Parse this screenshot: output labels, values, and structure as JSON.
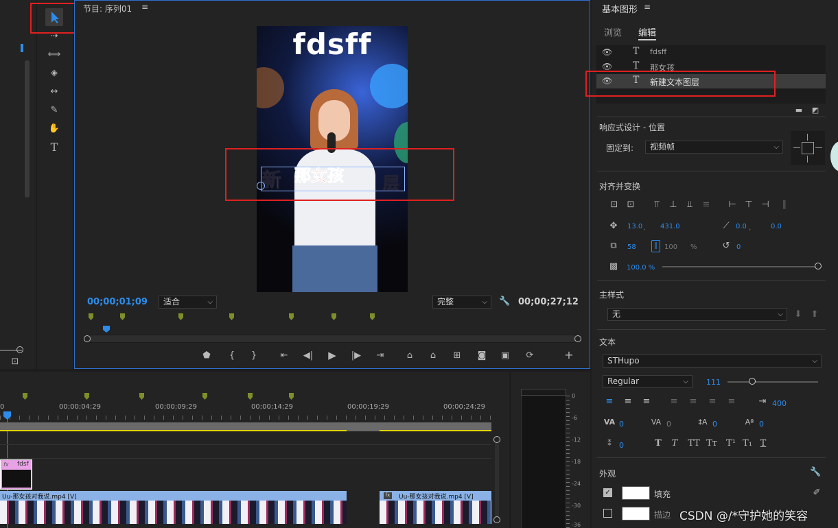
{
  "program": {
    "title": "节目: 序列01",
    "timecode_current": "00;00;01;09",
    "timecode_duration": "00;00;27;12",
    "zoom_select": "适合",
    "quality_select": "完整"
  },
  "video": {
    "title_text": "fdsff",
    "overlay_red": "那女孩",
    "overlay_white_left": "新",
    "overlay_white_right": "层"
  },
  "tools": [
    "selection-tool",
    "track-select-tool",
    "ripple-edit-tool",
    "razor-tool",
    "slip-tool",
    "pen-tool",
    "hand-tool",
    "type-tool"
  ],
  "essential_graphics": {
    "title": "基本图形",
    "tabs": [
      "浏览",
      "编辑"
    ],
    "layers": [
      "fdsff",
      "那女孩",
      "新建文本图层"
    ],
    "responsive_title": "响应式设计 - 位置",
    "pin_label": "固定到:",
    "pin_value": "视频帧",
    "align_title": "对齐并变换",
    "pos_x": "13.0",
    "pos_y": "431.0",
    "anchor_x": "0.0",
    "anchor_y": "0.0",
    "scale": "58",
    "scale2": "100",
    "scale_pct": "%",
    "rotation": "0",
    "opacity": "100.0 %",
    "master_style_title": "主样式",
    "master_style_value": "无",
    "text_title": "文本",
    "font": "STHupo",
    "font_style": "Regular",
    "font_size": "111",
    "leading": "400",
    "kerning": "0",
    "tracking": "0",
    "leading2": "0",
    "baseline": "0",
    "tsume": "0",
    "appearance_title": "外观",
    "fill_label": "填充",
    "stroke_label": "描边"
  },
  "timeline": {
    "ruler_labels": [
      "00;00;04;29",
      "00;00;09;29",
      "00;00;14;29",
      "00;00;19;29",
      "00;00;24;29"
    ],
    "ruler_zero": "0",
    "graphic_clip": "fdsf",
    "clip1_label": "Uu-那女孩对我说.mp4 [V]",
    "clip2_label": "Uu-那女孩对我说.mp4 [V]",
    "meter_labels": [
      "0",
      "-6",
      "-12",
      "-18",
      "-24",
      "-30",
      "-36"
    ]
  },
  "watermark": "CSDN @/*守护她的笑容",
  "colors": {
    "accent": "#2d8ceb",
    "highlight_red": "#e02020",
    "marker": "#7e8f2a",
    "fill_swatch": "#ffffff"
  }
}
